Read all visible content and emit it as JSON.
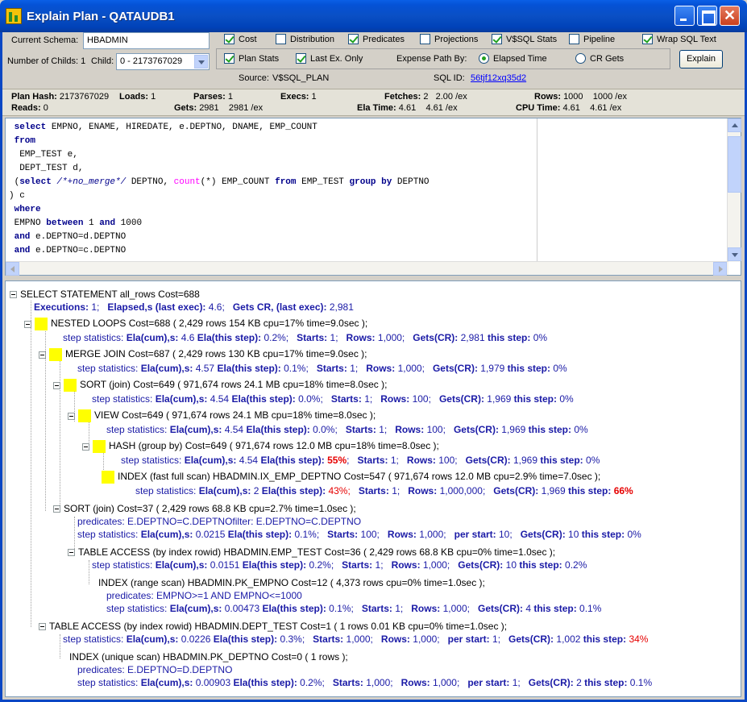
{
  "window": {
    "title": "Explain Plan - QATAUDB1"
  },
  "options": {
    "current_schema_label": "Current Schema:",
    "current_schema_value": "HBADMIN",
    "childs_label": "Number of Childs: 1",
    "child_label": "Child:",
    "child_value": "0 - 2173767029",
    "cost": "Cost",
    "distribution": "Distribution",
    "predicates": "Predicates",
    "projections": "Projections",
    "vsql_stats": "V$SQL Stats",
    "pipeline": "Pipeline",
    "wrap_sql": "Wrap SQL Text",
    "plan_stats": "Plan Stats",
    "last_ex_only": "Last Ex. Only",
    "expense_path_label": "Expense Path By:",
    "elapsed_time": "Elapsed Time",
    "cr_gets": "CR Gets",
    "explain_button": "Explain",
    "source_label": "Source:",
    "source_value": "V$SQL_PLAN",
    "sql_id_label": "SQL ID:",
    "sql_id_value": "56tjf12xq35d2"
  },
  "stats": {
    "plan_hash_label": "Plan Hash:",
    "plan_hash": "2173767029",
    "loads_label": "Loads:",
    "loads": "1",
    "parses_label": "Parses:",
    "parses": "1",
    "execs_label": "Execs:",
    "execs": "1",
    "fetches_label": "Fetches:",
    "fetches": "2",
    "fetches_ex": "2.00 /ex",
    "rows_label": "Rows:",
    "rows": "1000",
    "rows_ex": "1000 /ex",
    "reads_label": "Reads:",
    "reads": "0",
    "gets_label": "Gets:",
    "gets": "2981",
    "gets_ex": "2981 /ex",
    "ela_label": "Ela Time:",
    "ela": "4.61",
    "ela_ex": "4.61 /ex",
    "cpu_label": "CPU Time:",
    "cpu": "4.61",
    "cpu_ex": "4.61 /ex"
  },
  "sql": {
    "l1_kw": "select",
    "l1": " EMPNO, ENAME, HIREDATE, e.DEPTNO, DNAME, EMP_COUNT",
    "l2_kw": "from",
    "l3": "  EMP_TEST e,",
    "l4": "  DEPT_TEST d,",
    "l5_pre": " (",
    "l5_kw": "select",
    "l5_cm": " /*+no_merge*/",
    "l5_a": " DEPTNO, ",
    "l5_fn": "count",
    "l5_b": "(*) EMP_COUNT ",
    "l5_kw2": "from",
    "l5_c": " EMP_TEST ",
    "l5_kw3": "group by",
    "l5_d": " DEPTNO",
    "l6": ") c",
    "l7_kw": "where",
    "l8_a": " EMPNO ",
    "l8_kw": "between",
    "l8_b": " 1 ",
    "l8_kw2": "and",
    "l8_c": " 1000",
    "l9_kw": " and",
    "l9": " e.DEPTNO=d.DEPTNO",
    "l10_kw": " and",
    "l10": " e.DEPTNO=c.DEPTNO"
  },
  "plan": {
    "root": "SELECT STATEMENT all_rows   Cost=688",
    "root_exec_label": "Executions:",
    "root_exec": " 1;",
    "root_elapsed_label": "Elapsed,s (last exec):",
    "root_elapsed": " 4.6;",
    "root_gets_label": "Gets CR, (last exec):",
    "root_gets": " 2,981",
    "ss": "step statistics:",
    "ela_cum": "Ela(cum),s:",
    "ela_step": "Ela(this step):",
    "starts": "Starts:",
    "rows": "Rows:",
    "gets": "Gets(CR):",
    "this_step": "this step:",
    "per_start": "per start:",
    "predicates_label": "predicates:",
    "n1": "NESTED LOOPS   Cost=688  ( 2,429 rows  154 KB  cpu=17%  time=9.0sec );",
    "n1s": [
      "4.6",
      "0.2%;",
      "1;",
      "1,000;",
      "2,981",
      "0%"
    ],
    "n2": "MERGE JOIN   Cost=687  ( 2,429 rows  130 KB  cpu=17%  time=9.0sec );",
    "n2s": [
      "4.57",
      "0.1%;",
      "1;",
      "1,000;",
      "1,979",
      "0%"
    ],
    "n3": "SORT (join)    Cost=649  ( 971,674 rows  24.1 MB  cpu=18%  time=8.0sec );",
    "n3s": [
      "4.54",
      "0.0%;",
      "1;",
      "100;",
      "1,969",
      "0%"
    ],
    "n4": "VIEW   Cost=649  ( 971,674 rows  24.1 MB  cpu=18%  time=8.0sec );",
    "n4s": [
      "4.54",
      "0.0%;",
      "1;",
      "100;",
      "1,969",
      "0%"
    ],
    "n5": "HASH (group by)    Cost=649  ( 971,674 rows  12.0 MB  cpu=18%  time=8.0sec );",
    "n5s": [
      "4.54",
      "55%",
      "1;",
      "100;",
      "1,969",
      "0%"
    ],
    "n6": "INDEX (fast full scan)  HBADMIN.IX_EMP_DEPTNO   Cost=547  ( 971,674 rows  12.0 MB  cpu=2.9%  time=7.0sec );",
    "n6s": [
      "2",
      "43%;",
      "1;",
      "1,000,000;",
      "1,969",
      "66%"
    ],
    "n7": "SORT (join)    Cost=37  ( 2,429 rows  68.8 KB  cpu=2.7%  time=1.0sec );",
    "n7p": "E.DEPTNO=C.DEPTNOfilter: E.DEPTNO=C.DEPTNO",
    "n7s": [
      "0.0215",
      "0.1%;",
      "100;",
      "1,000;",
      "10;",
      "10",
      "0%"
    ],
    "n8": "TABLE ACCESS (by index rowid)  HBADMIN.EMP_TEST   Cost=36  ( 2,429 rows  68.8 KB  cpu=0%  time=1.0sec );",
    "n8s": [
      "0.0151",
      "0.2%;",
      "1;",
      "1,000;",
      "10",
      "0.2%"
    ],
    "n9": "INDEX (range scan)  HBADMIN.PK_EMPNO   Cost=12  ( 4,373 rows   cpu=0%  time=1.0sec );",
    "n9p": "EMPNO>=1 AND EMPNO<=1000",
    "n9s": [
      "0.00473",
      "0.1%;",
      "1;",
      "1,000;",
      "4",
      "0.1%"
    ],
    "n10": "TABLE ACCESS (by index rowid)  HBADMIN.DEPT_TEST   Cost=1  ( 1 rows  0.01 KB  cpu=0%  time=1.0sec );",
    "n10s": [
      "0.0226",
      "0.3%;",
      "1,000;",
      "1,000;",
      "1;",
      "1,002",
      "34%"
    ],
    "n11": "INDEX (unique scan)  HBADMIN.PK_DEPTNO   Cost=0  ( 1 rows  );",
    "n11p": "E.DEPTNO=D.DEPTNO",
    "n11s": [
      "0.00903",
      "0.2%;",
      "1,000;",
      "1,000;",
      "1;",
      "2",
      "0.1%"
    ]
  },
  "icons": [
    "app-icon",
    "minimize-icon",
    "maximize-icon",
    "close-icon",
    "expand-icon",
    "highlight-icon"
  ],
  "colors": {
    "titlebar": "#0a4fc4",
    "stats_blue": "#1a1aa6",
    "hot_red": "#e60000",
    "highlight": "#ffff00"
  }
}
